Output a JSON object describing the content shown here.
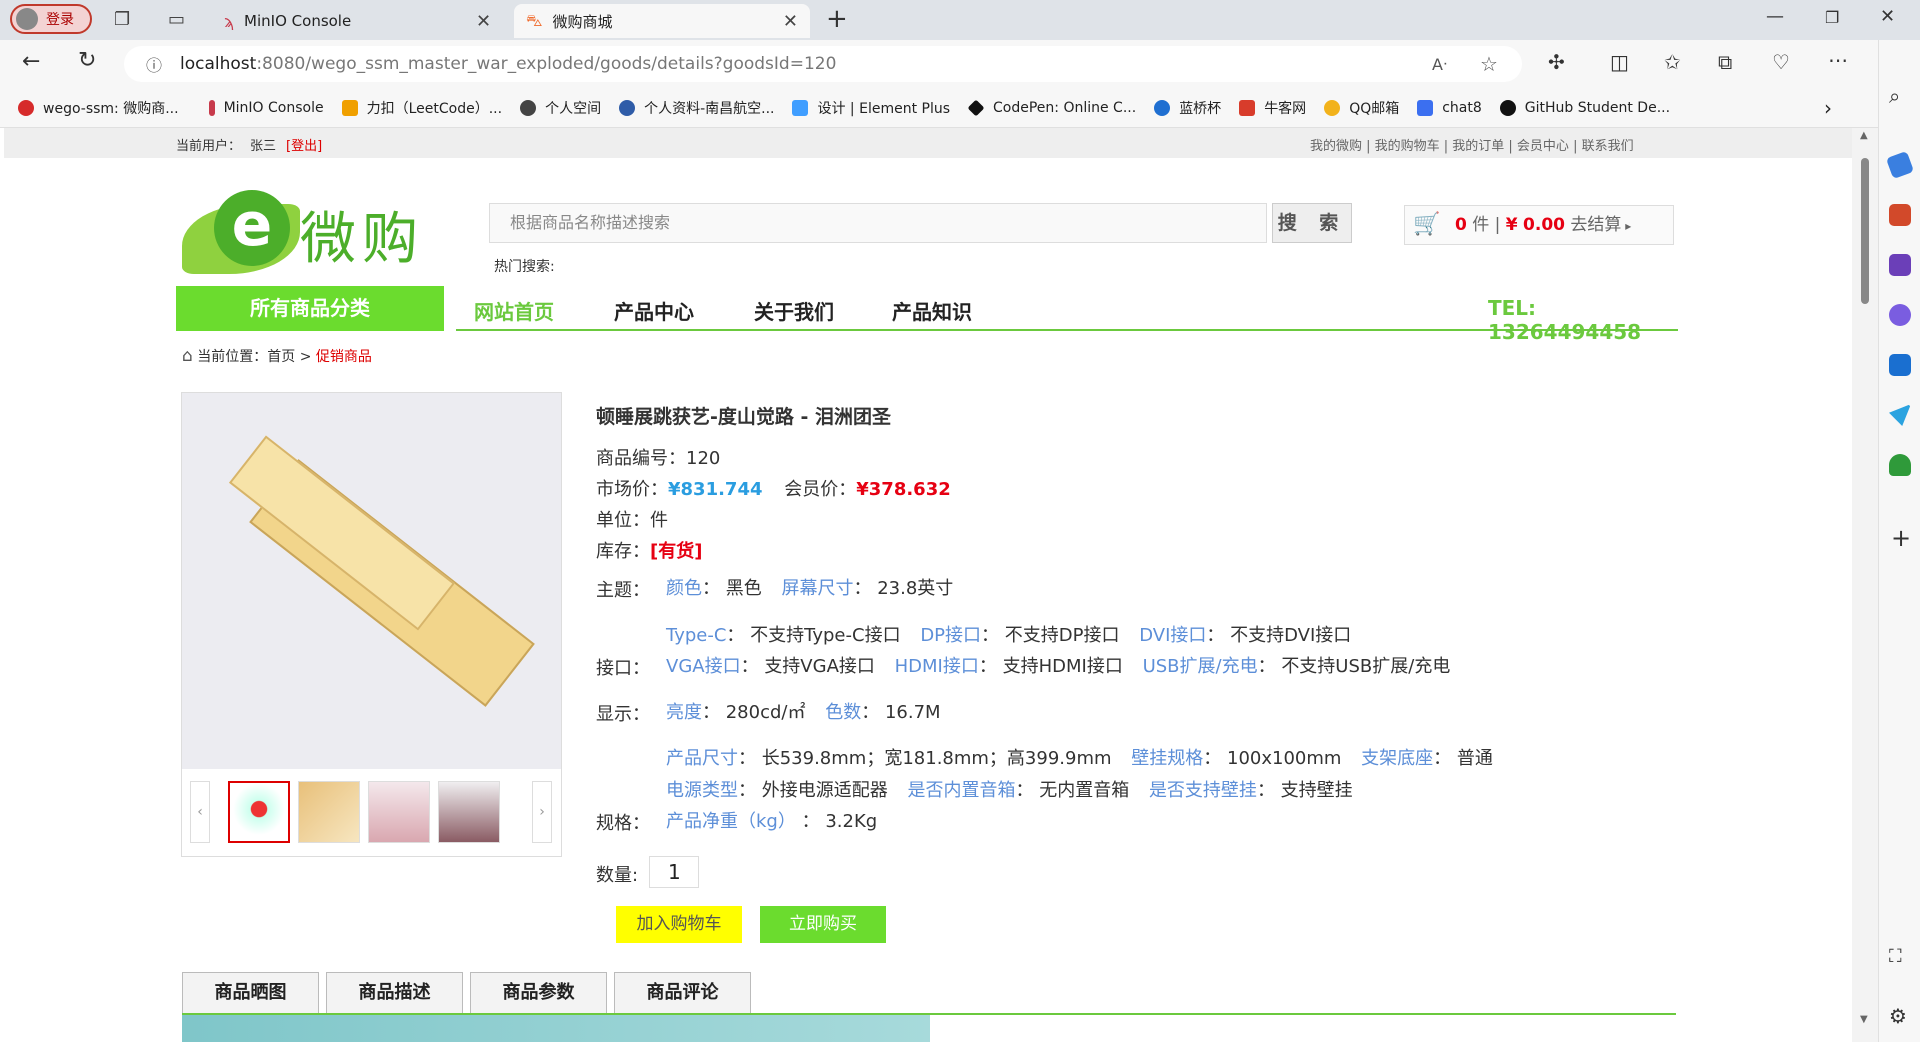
{
  "browser": {
    "profile_label": "登录",
    "tabs": [
      {
        "title": "MinIO Console"
      },
      {
        "title": "微购商城"
      }
    ],
    "url": {
      "host": "localhost",
      "rest": ":8080/wego_ssm_master_war_exploded/goods/details?goodsId=120"
    },
    "bookmarks": [
      {
        "label": "wego-ssm: 微购商...",
        "color": "#d62b2b"
      },
      {
        "label": "MinIO Console",
        "color": "#c73a4b"
      },
      {
        "label": "力扣（LeetCode）...",
        "color": "#f0a000"
      },
      {
        "label": "个人空间",
        "color": "#444444"
      },
      {
        "label": "个人资料-南昌航空...",
        "color": "#2f5ca8"
      },
      {
        "label": "设计 | Element Plus",
        "color": "#409eff"
      },
      {
        "label": "CodePen: Online C...",
        "color": "#111111"
      },
      {
        "label": "蓝桥杯",
        "color": "#1f6fd1"
      },
      {
        "label": "牛客网",
        "color": "#d83c2b"
      },
      {
        "label": "QQ邮箱",
        "color": "#f2b21b"
      },
      {
        "label": "chat8",
        "color": "#3b6ff0"
      },
      {
        "label": "GitHub Student De...",
        "color": "#111111"
      }
    ]
  },
  "site": {
    "topbar": {
      "current_user_label": "当前用户：",
      "user_name": "张三",
      "logout": "[登出]",
      "links": "我的微购 | 我的购物车 | 我的订单 | 会员中心 | 联系我们"
    },
    "logo_text": "微购",
    "search": {
      "placeholder": "根据商品名称描述搜索",
      "button": "搜 索",
      "hot_label": "热门搜索:"
    },
    "cart": {
      "count": "0",
      "count_unit": " 件 | ",
      "currency": "¥",
      "amount": "0.00",
      "checkout": "去结算"
    },
    "nav": {
      "category": "所有商品分类",
      "items": [
        "网站首页",
        "产品中心",
        "关于我们",
        "产品知识"
      ],
      "tel": "TEL:  13264494458"
    },
    "breadcrumb": {
      "prefix": "当前位置：",
      "home": "首页",
      "sep": " > ",
      "current": "促销商品"
    }
  },
  "product": {
    "title": "顿睡展跳获艺-度山觉路 - 泪洲团圣",
    "id_label": "商品编号：",
    "id": "120",
    "market_label": "市场价：",
    "market_price": "¥831.744",
    "member_label": "会员价：",
    "member_price": "¥378.632",
    "unit_label": "单位：",
    "unit": "件",
    "stock_label": "库存：",
    "stock": "[有货]",
    "spec_groups": {
      "theme_label": "主题：",
      "theme": [
        {
          "k": "颜色",
          "v": "黑色"
        },
        {
          "k": "屏幕尺寸",
          "v": "23.8英寸"
        }
      ],
      "port_label": "接口：",
      "port_row1": [
        {
          "k": "Type-C",
          "v": "不支持Type-C接口"
        },
        {
          "k": "DP接口",
          "v": "不支持DP接口"
        },
        {
          "k": "DVI接口",
          "v": "不支持DVI接口"
        }
      ],
      "port_row2": [
        {
          "k": "VGA接口",
          "v": "支持VGA接口"
        },
        {
          "k": "HDMI接口",
          "v": "支持HDMI接口"
        },
        {
          "k": "USB扩展/充电",
          "v": "不支持USB扩展/充电"
        }
      ],
      "display_label": "显示：",
      "display": [
        {
          "k": "亮度",
          "v": "280cd/㎡"
        },
        {
          "k": "色数",
          "v": "16.7M"
        }
      ],
      "spec_label": "规格：",
      "spec_row1": [
        {
          "k": "产品尺寸",
          "v": "长539.8mm；宽181.8mm；高399.9mm"
        },
        {
          "k": "壁挂规格",
          "v": "100x100mm"
        },
        {
          "k": "支架底座",
          "v": "普通"
        }
      ],
      "spec_row2": [
        {
          "k": "电源类型",
          "v": "外接电源适配器"
        },
        {
          "k": "是否内置音箱",
          "v": "无内置音箱"
        },
        {
          "k": "是否支持壁挂",
          "v": "支持壁挂"
        }
      ],
      "spec_row3": [
        {
          "k": "产品净重（kg）",
          "v": "3.2Kg"
        }
      ]
    },
    "qty_label": "数量:",
    "qty": "1",
    "add_cart": "加入购物车",
    "buy_now": "立即购买",
    "detail_tabs": [
      "商品晒图",
      "商品描述",
      "商品参数",
      "商品评论"
    ]
  }
}
